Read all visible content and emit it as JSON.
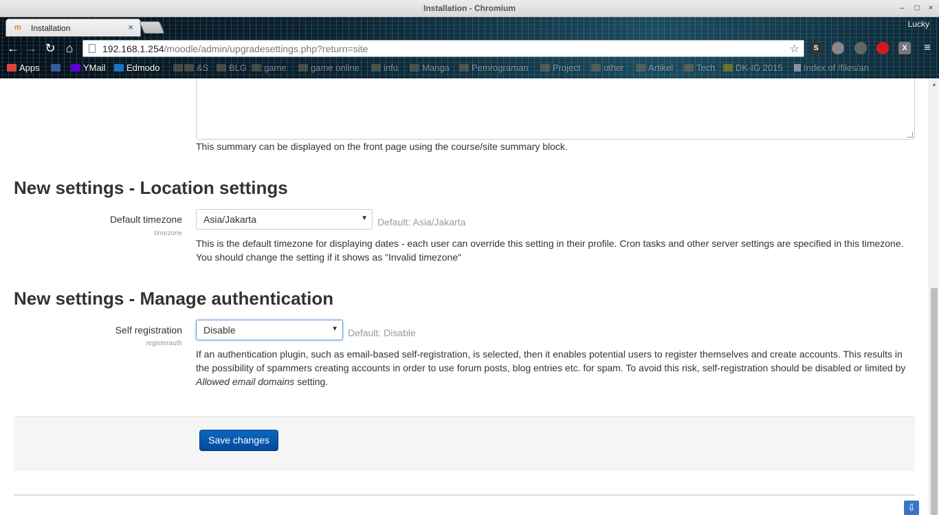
{
  "window": {
    "title": "Installation - Chromium",
    "minimize_icon": "minimize-icon",
    "maximize_icon": "maximize-icon",
    "close_icon": "close-icon"
  },
  "tab": {
    "label": "Installation",
    "favicon_text": "m",
    "close_glyph": "×"
  },
  "profile": {
    "name": "Lucky"
  },
  "toolbar": {
    "url_host": "192.168.1.254",
    "url_path": "/moodle/admin/upgradesettings.php?return=site",
    "extensions": [
      "S",
      "",
      "",
      "",
      "X"
    ]
  },
  "bookmarks": [
    {
      "label": "Apps",
      "icon": "apps-grid-icon",
      "color": "#d9473a"
    },
    {
      "label": "",
      "icon": "facebook-icon",
      "color": "#3b5998"
    },
    {
      "label": "YMail",
      "icon": "yahoo-icon",
      "color": "#5f01d1"
    },
    {
      "label": "Edmodo",
      "icon": "edmodo-icon",
      "color": "#1a73c9"
    },
    {
      "label": "",
      "icon": "folder-icon",
      "color": "#8a7a5a"
    },
    {
      "label": "&S",
      "icon": "folder-icon",
      "color": "#8a7a5a"
    },
    {
      "label": "BLG",
      "icon": "folder-icon",
      "color": "#8a7a5a"
    },
    {
      "label": "game",
      "icon": "folder-icon",
      "color": "#8a7a5a"
    },
    {
      "label": "game online",
      "icon": "folder-icon",
      "color": "#8a7a5a"
    },
    {
      "label": "info",
      "icon": "folder-icon",
      "color": "#8a7a5a"
    },
    {
      "label": "Manga",
      "icon": "folder-icon",
      "color": "#8a7a5a"
    },
    {
      "label": "Pemrograman",
      "icon": "folder-icon",
      "color": "#8a7a5a"
    },
    {
      "label": "Project",
      "icon": "folder-icon",
      "color": "#8a7a5a"
    },
    {
      "label": "other",
      "icon": "folder-icon",
      "color": "#8a7a5a"
    },
    {
      "label": "Artikel",
      "icon": "folder-icon",
      "color": "#8a7a5a"
    },
    {
      "label": "Tech",
      "icon": "folder-icon",
      "color": "#8a7a5a"
    },
    {
      "label": "DK-IG 2015",
      "icon": "dk-icon",
      "color": "#c9a200"
    },
    {
      "label": "Index of /files/an",
      "icon": "page-icon",
      "color": "#ffffff"
    }
  ],
  "content": {
    "summary_description": "This summary can be displayed on the front page using the course/site summary block.",
    "location": {
      "heading": "New settings - Location settings",
      "timezone_label": "Default timezone",
      "timezone_key": "timezone",
      "timezone_value": "Asia/Jakarta",
      "timezone_default": "Default: Asia/Jakarta",
      "timezone_desc_line1": "This is the default timezone for displaying dates - each user can override this setting in their profile. Cron tasks and other server settings are specified in this timezone.",
      "timezone_desc_line2": "You should change the setting if it shows as \"Invalid timezone\""
    },
    "auth": {
      "heading": "New settings - Manage authentication",
      "registration_label": "Self registration",
      "registration_key": "registerauth",
      "registration_value": "Disable",
      "registration_default": "Default: Disable",
      "registration_desc_line1": "If an authentication plugin, such as email-based self-registration, is selected, then it enables potential users to register themselves and create accounts. This results in",
      "registration_desc_line2": "the possibility of spammers creating accounts in order to use forum posts, blog entries etc. for spam. To avoid this risk, self-registration should be disabled or limited by",
      "registration_desc_em": "Allowed email domains",
      "registration_desc_tail": " setting."
    },
    "save_label": "Save changes"
  }
}
